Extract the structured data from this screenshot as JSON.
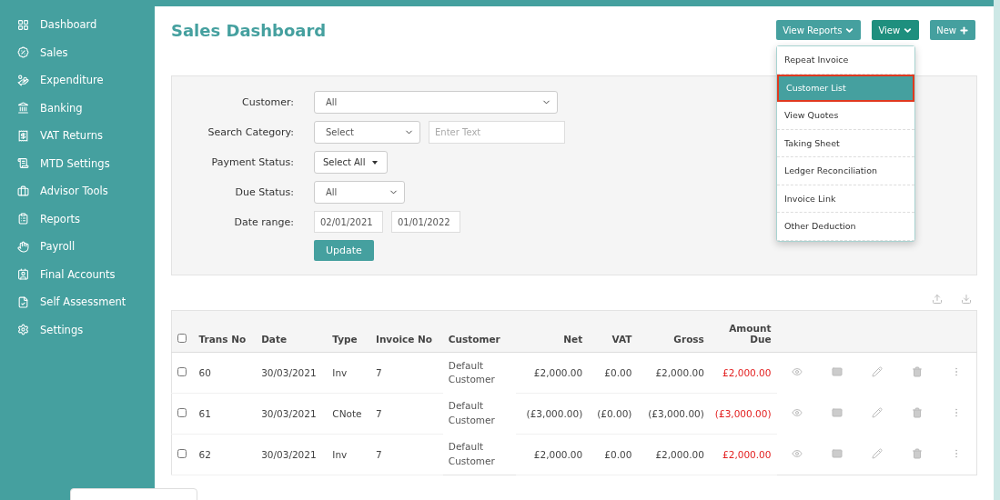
{
  "sidebar": {
    "items": [
      {
        "label": "Dashboard",
        "selected": false
      },
      {
        "label": "Sales",
        "selected": false
      },
      {
        "label": "Expenditure",
        "selected": false
      },
      {
        "label": "Banking",
        "selected": false
      },
      {
        "label": "VAT Returns",
        "selected": false
      },
      {
        "label": "MTD Settings",
        "selected": false
      },
      {
        "label": "Advisor Tools",
        "selected": false
      },
      {
        "label": "Reports",
        "selected": false
      },
      {
        "label": "Payroll",
        "selected": false
      },
      {
        "label": "Final Accounts",
        "selected": false
      },
      {
        "label": "Self Assessment",
        "selected": false
      },
      {
        "label": "Settings",
        "selected": false
      }
    ]
  },
  "page": {
    "title": "Sales Dashboard"
  },
  "header_buttons": [
    {
      "label": "View Reports",
      "kind": "dropdown",
      "selected": false
    },
    {
      "label": "View",
      "kind": "dropdown",
      "selected": true
    },
    {
      "label": "New",
      "kind": "add",
      "selected": false
    }
  ],
  "view_menu": {
    "items": [
      {
        "label": "Repeat Invoice",
        "selected": false
      },
      {
        "label": "Customer List",
        "selected": true
      },
      {
        "label": "View Quotes",
        "selected": false
      },
      {
        "label": "Taking Sheet",
        "selected": false
      },
      {
        "label": "Ledger Reconciliation",
        "selected": false
      },
      {
        "label": "Invoice Link",
        "selected": false
      },
      {
        "label": "Other Deduction",
        "selected": false
      }
    ]
  },
  "filters": [
    {
      "label": "Customer:",
      "controls": [
        {
          "kind": "select",
          "value": "All"
        }
      ]
    },
    {
      "label": "Search Category:",
      "controls": [
        {
          "kind": "select",
          "value": "Select"
        },
        {
          "kind": "text",
          "placeholder": "Enter Text"
        }
      ]
    },
    {
      "label": "Payment Status:",
      "controls": [
        {
          "kind": "menu-button",
          "value": "Select All"
        }
      ]
    },
    {
      "label": "Due Status:",
      "controls": [
        {
          "kind": "select",
          "value": "All"
        }
      ]
    },
    {
      "label": "Date range:",
      "controls": [
        {
          "kind": "date",
          "value": "02/01/2021"
        },
        {
          "kind": "date",
          "value": "01/01/2022"
        }
      ]
    }
  ],
  "update_button": {
    "label": "Update"
  },
  "table": {
    "select_all": {
      "checked": false
    },
    "columns": [
      "Trans No",
      "Date",
      "Type",
      "Invoice No",
      "Customer",
      "Net",
      "VAT",
      "Gross",
      "Amount Due"
    ],
    "rows": [
      {
        "checked": false,
        "cells": [
          "60",
          "30/03/2021",
          "Inv",
          "7",
          "Default Customer",
          "£2,000.00",
          "£0.00",
          "£2,000.00",
          "£2,000.00"
        ]
      },
      {
        "checked": false,
        "cells": [
          "61",
          "30/03/2021",
          "CNote",
          "7",
          "Default Customer",
          "(£3,000.00)",
          "(£0.00)",
          "(£3,000.00)",
          "(£3,000.00)"
        ]
      },
      {
        "checked": false,
        "cells": [
          "62",
          "30/03/2021",
          "Inv",
          "7",
          "Default Customer",
          "£2,000.00",
          "£0.00",
          "£2,000.00",
          "£2,000.00"
        ]
      }
    ]
  }
}
